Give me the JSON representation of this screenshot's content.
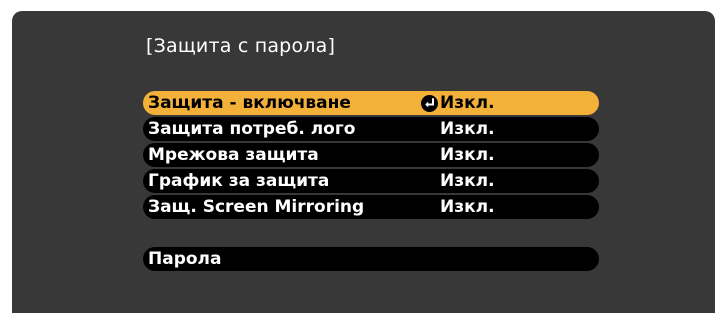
{
  "menu": {
    "title": "[Защита с парола]",
    "items": [
      {
        "label": "Защита - включване",
        "value": "Изкл.",
        "selected": true
      },
      {
        "label": "Защита потреб. лого",
        "value": "Изкл."
      },
      {
        "label": "Мрежова защита",
        "value": "Изкл."
      },
      {
        "label": "График за защита",
        "value": "Изкл."
      },
      {
        "label": "Защ. Screen Mirroring",
        "value": "Изкл."
      }
    ],
    "password_item": {
      "label": "Парола"
    }
  },
  "colors": {
    "panel_background": "#383838",
    "row_background": "#000000",
    "highlight": "#f4b13a",
    "text": "#ffffff",
    "highlight_text": "#000000"
  },
  "icons": {
    "enter": "enter-icon"
  }
}
